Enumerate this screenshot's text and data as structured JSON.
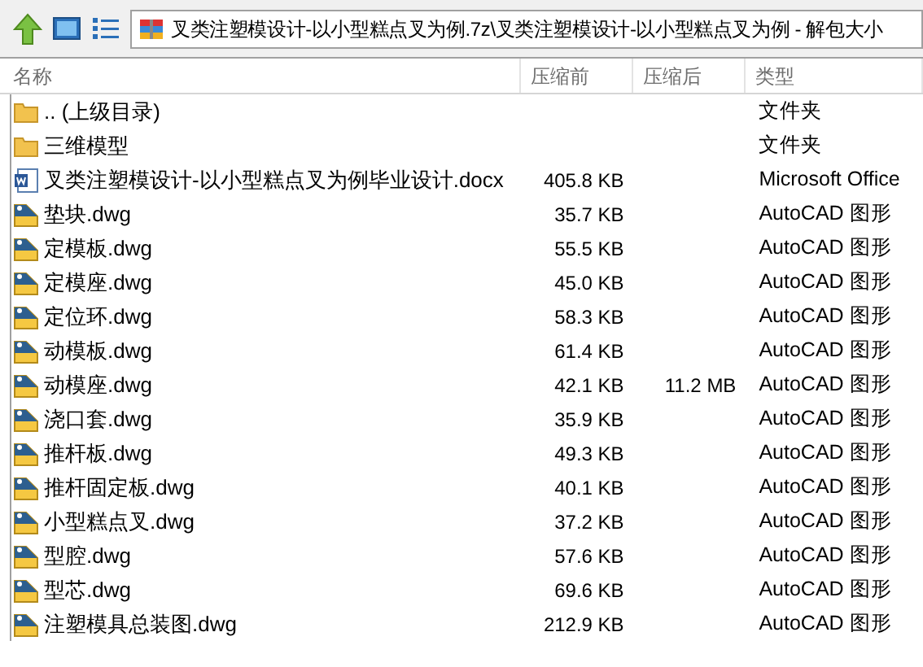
{
  "address_bar": {
    "path": "叉类注塑模设计-以小型糕点叉为例.7z\\叉类注塑模设计-以小型糕点叉为例 - 解包大小"
  },
  "table": {
    "columns": [
      "名称",
      "压缩前",
      "压缩后",
      "类型"
    ],
    "rows": [
      {
        "kind": "folder",
        "name": ".. (上级目录)",
        "size": "",
        "packed": "",
        "type": "文件夹"
      },
      {
        "kind": "folder",
        "name": "三维模型",
        "size": "",
        "packed": "",
        "type": "文件夹"
      },
      {
        "kind": "docx",
        "name": "叉类注塑模设计-以小型糕点叉为例毕业设计.docx",
        "size": "405.8 KB",
        "packed": "",
        "type": "Microsoft Office"
      },
      {
        "kind": "dwg",
        "name": "垫块.dwg",
        "size": "35.7 KB",
        "packed": "",
        "type": "AutoCAD 图形"
      },
      {
        "kind": "dwg",
        "name": "定模板.dwg",
        "size": "55.5 KB",
        "packed": "",
        "type": "AutoCAD 图形"
      },
      {
        "kind": "dwg",
        "name": "定模座.dwg",
        "size": "45.0 KB",
        "packed": "",
        "type": "AutoCAD 图形"
      },
      {
        "kind": "dwg",
        "name": "定位环.dwg",
        "size": "58.3 KB",
        "packed": "",
        "type": "AutoCAD 图形"
      },
      {
        "kind": "dwg",
        "name": "动模板.dwg",
        "size": "61.4 KB",
        "packed": "",
        "type": "AutoCAD 图形"
      },
      {
        "kind": "dwg",
        "name": "动模座.dwg",
        "size": "42.1 KB",
        "packed": "11.2 MB",
        "type": "AutoCAD 图形"
      },
      {
        "kind": "dwg",
        "name": "浇口套.dwg",
        "size": "35.9 KB",
        "packed": "",
        "type": "AutoCAD 图形"
      },
      {
        "kind": "dwg",
        "name": "推杆板.dwg",
        "size": "49.3 KB",
        "packed": "",
        "type": "AutoCAD 图形"
      },
      {
        "kind": "dwg",
        "name": "推杆固定板.dwg",
        "size": "40.1 KB",
        "packed": "",
        "type": "AutoCAD 图形"
      },
      {
        "kind": "dwg",
        "name": "小型糕点叉.dwg",
        "size": "37.2 KB",
        "packed": "",
        "type": "AutoCAD 图形"
      },
      {
        "kind": "dwg",
        "name": "型腔.dwg",
        "size": "57.6 KB",
        "packed": "",
        "type": "AutoCAD 图形"
      },
      {
        "kind": "dwg",
        "name": "型芯.dwg",
        "size": "69.6 KB",
        "packed": "",
        "type": "AutoCAD 图形"
      },
      {
        "kind": "dwg",
        "name": "注塑模具总装图.dwg",
        "size": "212.9 KB",
        "packed": "",
        "type": "AutoCAD 图形"
      }
    ]
  }
}
